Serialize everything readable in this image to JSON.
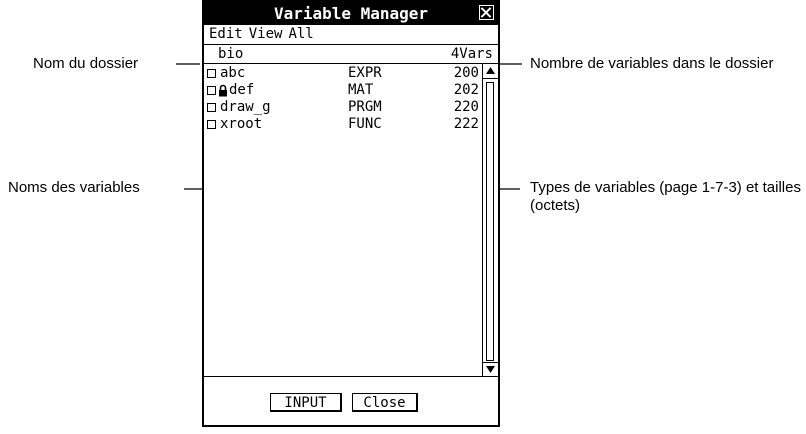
{
  "window": {
    "title": "Variable Manager",
    "menu": [
      "Edit",
      "View",
      "All"
    ]
  },
  "folder": {
    "name": "bio",
    "count": "4Vars"
  },
  "variables": [
    {
      "name": "abc",
      "type": "EXPR",
      "size": "200",
      "locked": false
    },
    {
      "name": "def",
      "type": "MAT",
      "size": "202",
      "locked": true
    },
    {
      "name": "draw_g",
      "type": "PRGM",
      "size": "220",
      "locked": false
    },
    {
      "name": "xroot",
      "type": "FUNC",
      "size": "222",
      "locked": false
    }
  ],
  "buttons": {
    "input": "INPUT",
    "close": "Close"
  },
  "annotations": {
    "folder_name": "Nom du dossier",
    "var_count": "Nombre de variables dans le dossier",
    "var_names": "Noms des variables",
    "var_types": "Types de variables (page 1-7-3) et tailles (octets)"
  }
}
